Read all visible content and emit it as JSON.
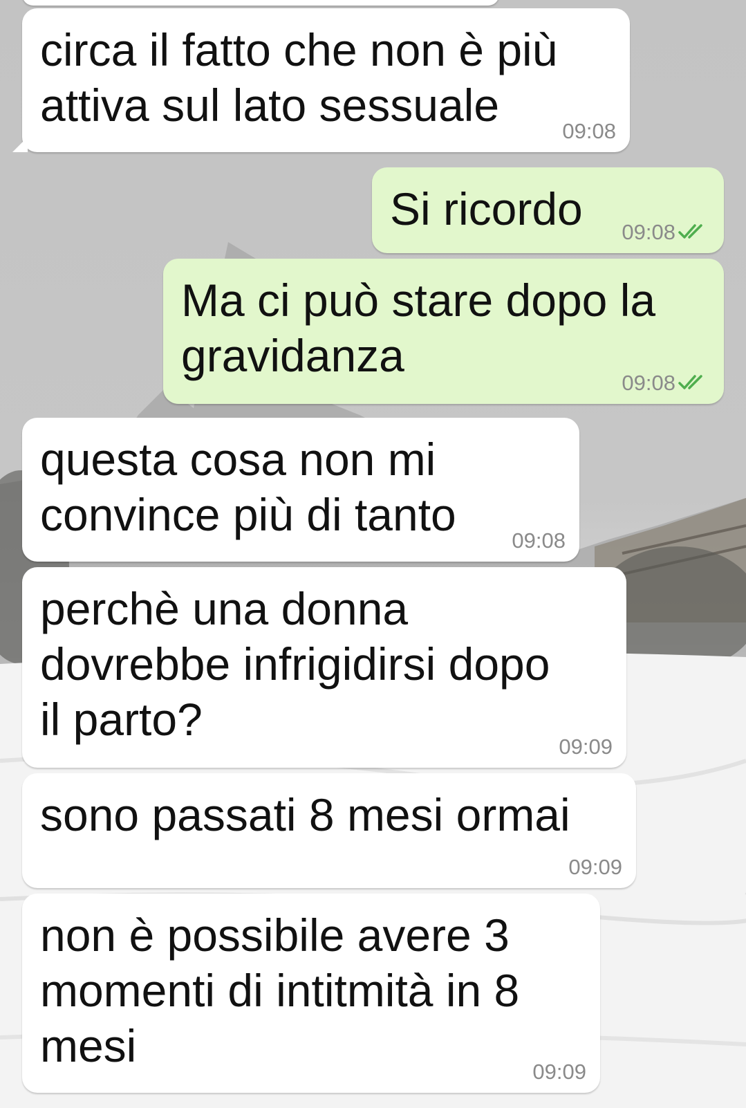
{
  "messages": [
    {
      "direction": "incoming",
      "text": "circa il fatto che non è più\nattiva sul lato sessuale",
      "time": "09:08"
    },
    {
      "direction": "outgoing",
      "text": "Si ricordo",
      "time": "09:08",
      "status": "read-double-check-icon"
    },
    {
      "direction": "outgoing",
      "text": "Ma ci può stare dopo la\ngravidanza",
      "time": "09:08",
      "status": "read-double-check-icon"
    },
    {
      "direction": "incoming",
      "text": "questa cosa non mi\nconvince più di tanto",
      "time": "09:08"
    },
    {
      "direction": "incoming",
      "text": "perchè una donna\ndovrebbe infrigidirsi dopo\nil parto?",
      "time": "09:09"
    },
    {
      "direction": "incoming",
      "text": "sono passati 8 mesi ormai",
      "time": "09:09"
    },
    {
      "direction": "incoming",
      "text": "non è possibile avere 3\nmomenti di intitmità in 8\nmesi",
      "time": "09:09"
    }
  ],
  "colors": {
    "incoming_bubble": "#ffffff",
    "outgoing_bubble": "#e2f7cc",
    "timestamp": "#8a8a8a",
    "read_ticks": "#4fae4e"
  }
}
